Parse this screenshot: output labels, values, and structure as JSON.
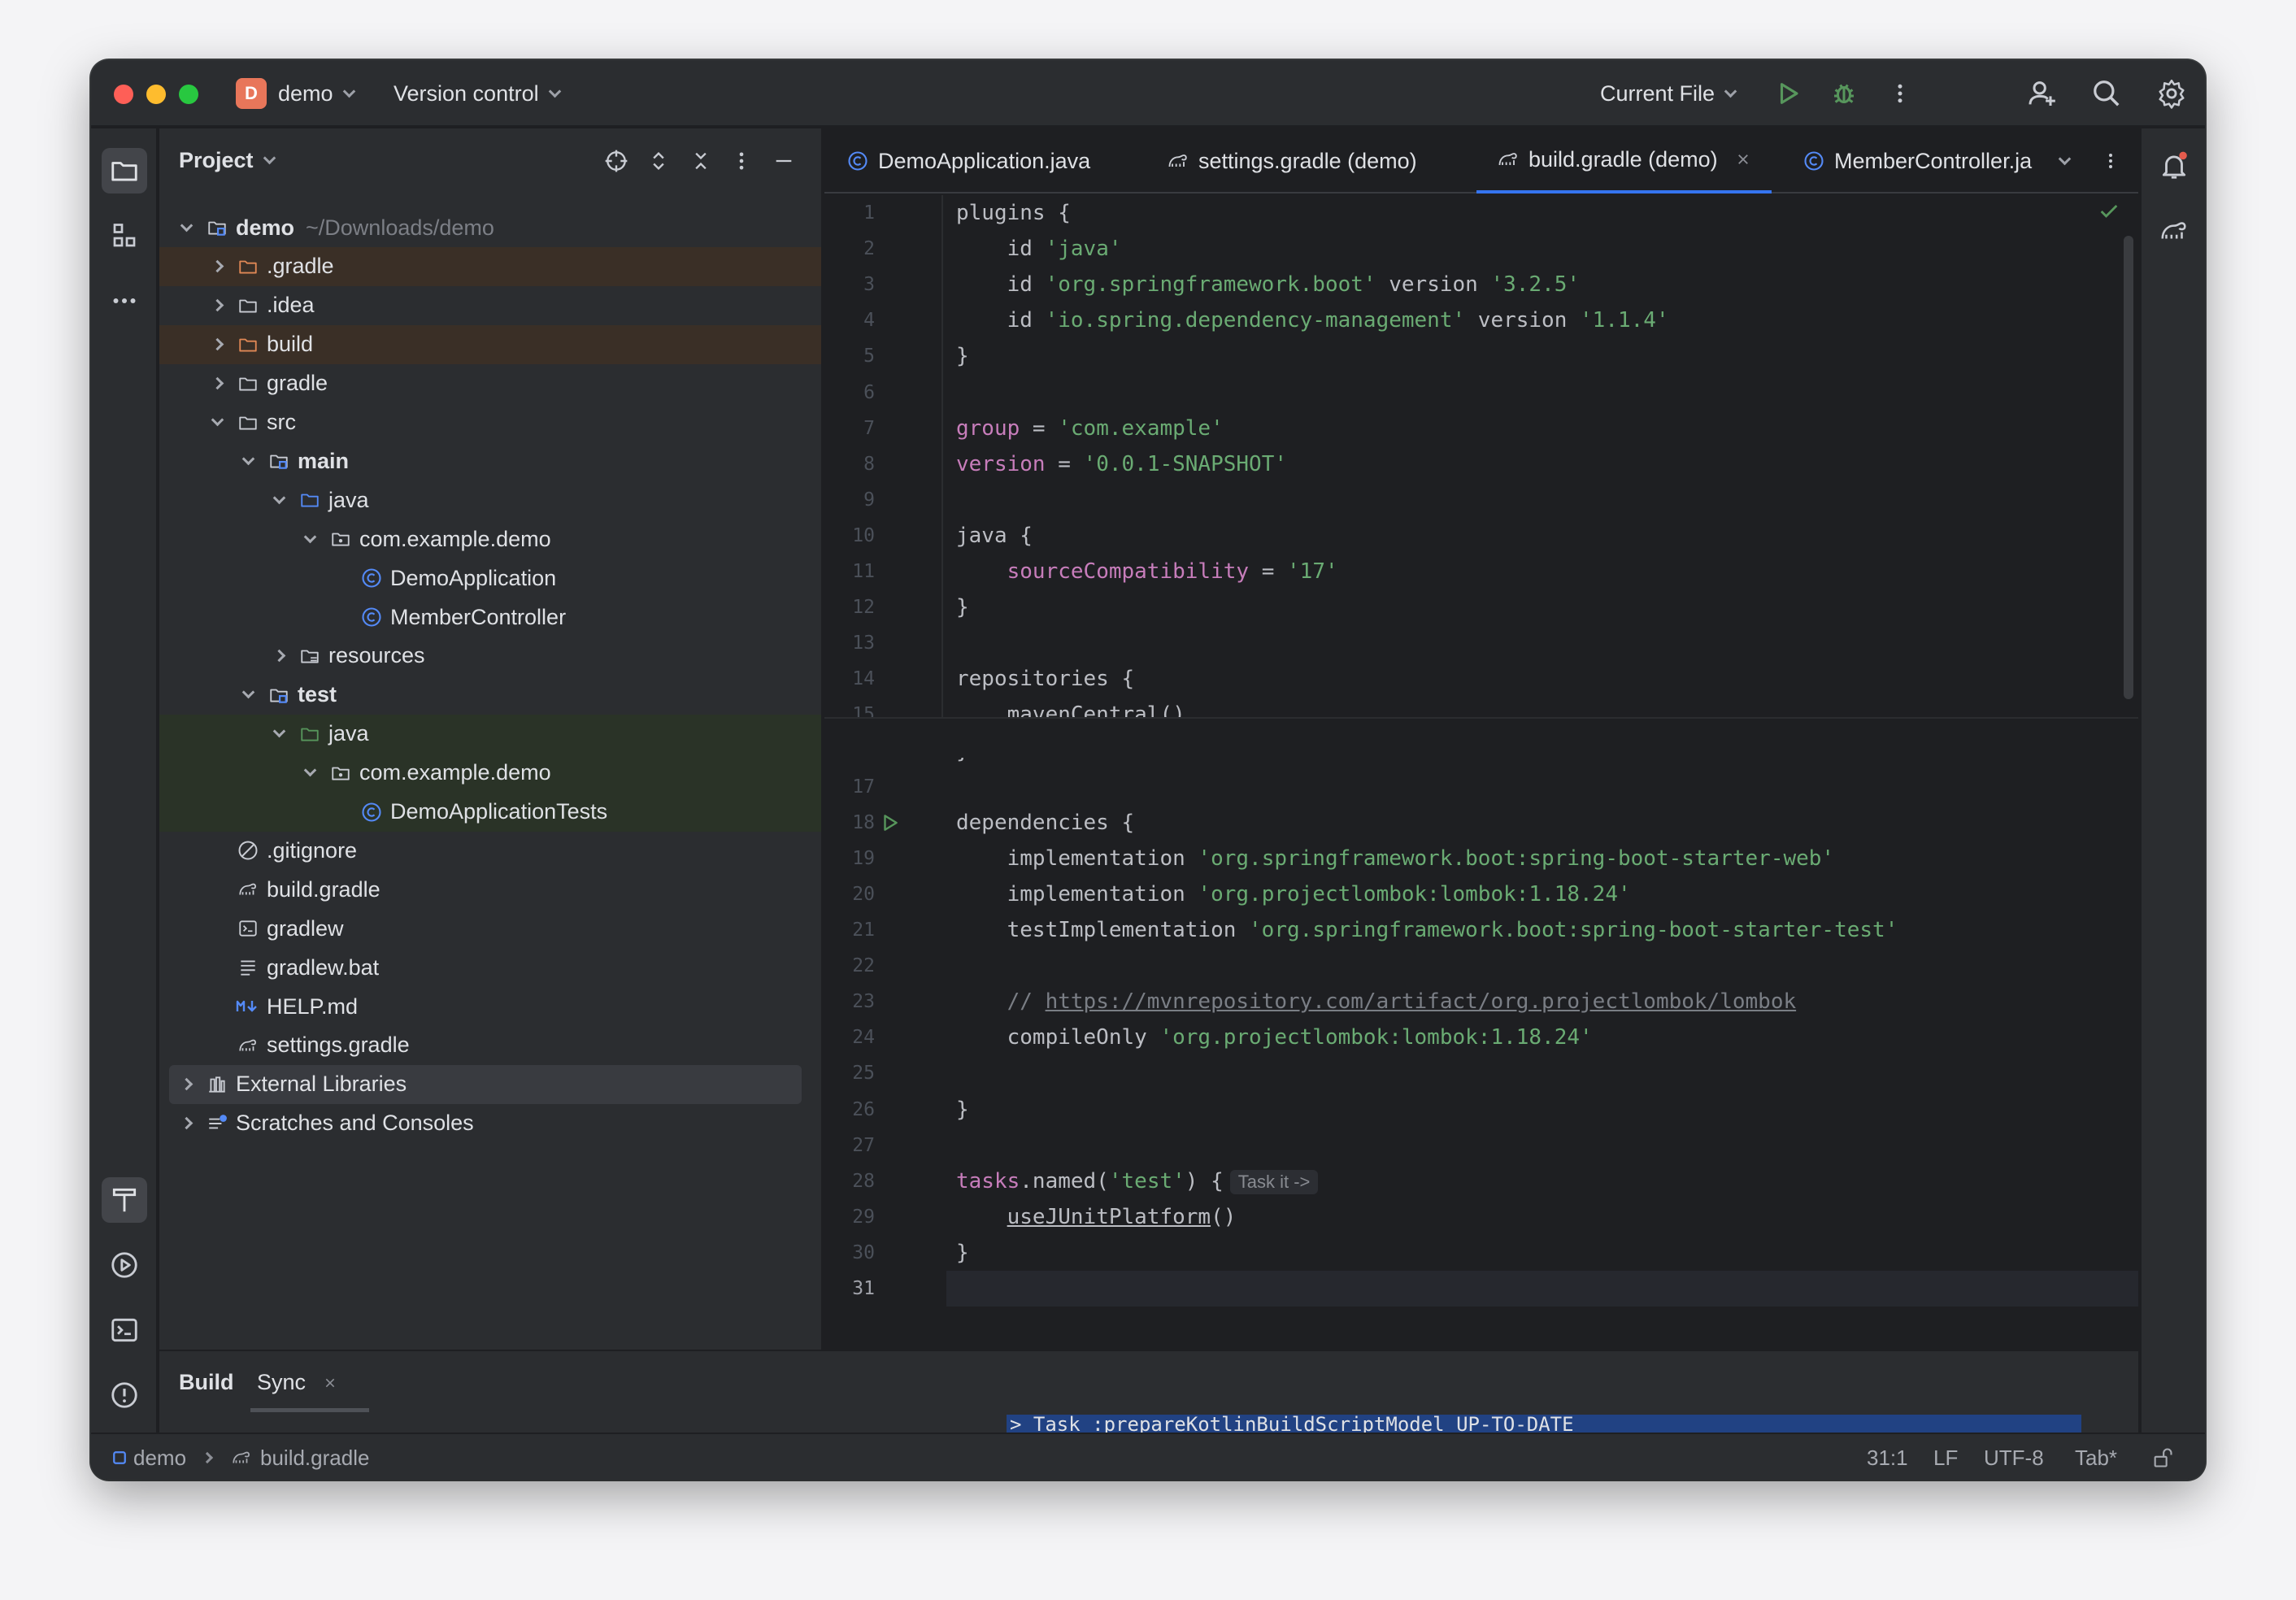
{
  "titlebar": {
    "project_badge": "D",
    "project_name": "demo",
    "vcs_label": "Version control",
    "run_config": "Current File"
  },
  "project_panel": {
    "title": "Project",
    "tree": [
      {
        "label": "demo",
        "hint": "~/Downloads/demo",
        "depth": 0,
        "expanded": true,
        "icon": "module-folder-icon",
        "bold": true
      },
      {
        "label": ".gradle",
        "depth": 1,
        "expanded": false,
        "icon": "excluded-folder-icon",
        "highlight": "excluded"
      },
      {
        "label": ".idea",
        "depth": 1,
        "expanded": false,
        "icon": "folder-icon"
      },
      {
        "label": "build",
        "depth": 1,
        "expanded": false,
        "icon": "excluded-folder-icon",
        "highlight": "excluded"
      },
      {
        "label": "gradle",
        "depth": 1,
        "expanded": false,
        "icon": "folder-icon"
      },
      {
        "label": "src",
        "depth": 1,
        "expanded": true,
        "icon": "folder-icon"
      },
      {
        "label": "main",
        "depth": 2,
        "expanded": true,
        "icon": "module-folder-icon",
        "bold": true
      },
      {
        "label": "java",
        "depth": 3,
        "expanded": true,
        "icon": "source-folder-icon"
      },
      {
        "label": "com.example.demo",
        "depth": 4,
        "expanded": true,
        "icon": "package-icon"
      },
      {
        "label": "DemoApplication",
        "depth": 5,
        "icon": "java-class-icon"
      },
      {
        "label": "MemberController",
        "depth": 5,
        "icon": "java-class-icon"
      },
      {
        "label": "resources",
        "depth": 3,
        "expanded": false,
        "icon": "resources-folder-icon"
      },
      {
        "label": "test",
        "depth": 2,
        "expanded": true,
        "icon": "module-folder-icon",
        "bold": true
      },
      {
        "label": "java",
        "depth": 3,
        "expanded": true,
        "icon": "test-folder-icon",
        "highlight": "test"
      },
      {
        "label": "com.example.demo",
        "depth": 4,
        "expanded": true,
        "icon": "package-icon",
        "highlight": "test"
      },
      {
        "label": "DemoApplicationTests",
        "depth": 5,
        "icon": "java-class-icon",
        "highlight": "test"
      },
      {
        "label": ".gitignore",
        "depth": 1,
        "icon": "gitignore-icon"
      },
      {
        "label": "build.gradle",
        "depth": 1,
        "icon": "gradle-icon"
      },
      {
        "label": "gradlew",
        "depth": 1,
        "icon": "shell-script-icon"
      },
      {
        "label": "gradlew.bat",
        "depth": 1,
        "icon": "text-file-icon"
      },
      {
        "label": "HELP.md",
        "depth": 1,
        "icon": "markdown-icon"
      },
      {
        "label": "settings.gradle",
        "depth": 1,
        "icon": "gradle-icon"
      },
      {
        "label": "External Libraries",
        "depth": 0,
        "expanded": false,
        "icon": "libraries-icon",
        "highlight": "selected"
      },
      {
        "label": "Scratches and Consoles",
        "depth": 0,
        "expanded": false,
        "icon": "scratches-icon"
      }
    ]
  },
  "tabs": [
    {
      "label": "DemoApplication.java",
      "icon": "java-class-icon"
    },
    {
      "label": "settings.gradle (demo)",
      "icon": "gradle-icon"
    },
    {
      "label": "build.gradle (demo)",
      "icon": "gradle-icon",
      "active": true
    },
    {
      "label": "MemberController.ja",
      "icon": "java-class-icon"
    }
  ],
  "editor": {
    "current_line": 31,
    "lines": [
      [
        {
          "t": "plugins {",
          "c": "kw"
        }
      ],
      [
        {
          "t": "    id ",
          "c": "kw"
        },
        {
          "t": "'java'",
          "c": "st"
        }
      ],
      [
        {
          "t": "    id ",
          "c": "kw"
        },
        {
          "t": "'org.springframework.boot'",
          "c": "st"
        },
        {
          "t": " version ",
          "c": "kw"
        },
        {
          "t": "'3.2.5'",
          "c": "st"
        }
      ],
      [
        {
          "t": "    id ",
          "c": "kw"
        },
        {
          "t": "'io.spring.dependency-management'",
          "c": "st"
        },
        {
          "t": " version ",
          "c": "kw"
        },
        {
          "t": "'1.1.4'",
          "c": "st"
        }
      ],
      [
        {
          "t": "}",
          "c": "kw"
        }
      ],
      [],
      [
        {
          "t": "group",
          "c": "pr"
        },
        {
          "t": " = ",
          "c": "kw"
        },
        {
          "t": "'com.example'",
          "c": "st"
        }
      ],
      [
        {
          "t": "version",
          "c": "pr"
        },
        {
          "t": " = ",
          "c": "kw"
        },
        {
          "t": "'0.0.1-SNAPSHOT'",
          "c": "st"
        }
      ],
      [],
      [
        {
          "t": "java {",
          "c": "kw"
        }
      ],
      [
        {
          "t": "    ",
          "c": "kw"
        },
        {
          "t": "sourceCompatibility",
          "c": "pr"
        },
        {
          "t": " = ",
          "c": "kw"
        },
        {
          "t": "'17'",
          "c": "st"
        }
      ],
      [
        {
          "t": "}",
          "c": "kw"
        }
      ],
      [],
      [
        {
          "t": "repositories {",
          "c": "kw"
        }
      ],
      [
        {
          "t": "    mavenCentral()",
          "c": "kw"
        }
      ],
      [
        {
          "t": "}",
          "c": "kw"
        }
      ],
      [],
      [
        {
          "t": "dependencies {",
          "c": "kw"
        }
      ],
      [
        {
          "t": "    implementation ",
          "c": "kw"
        },
        {
          "t": "'org.springframework.boot:spring-boot-starter-web'",
          "c": "st"
        }
      ],
      [
        {
          "t": "    implementation ",
          "c": "kw"
        },
        {
          "t": "'org.projectlombok:lombok:1.18.24'",
          "c": "st"
        }
      ],
      [
        {
          "t": "    testImplementation ",
          "c": "kw"
        },
        {
          "t": "'org.springframework.boot:spring-boot-starter-test'",
          "c": "st"
        }
      ],
      [],
      [
        {
          "t": "    // ",
          "c": "cm"
        },
        {
          "t": "https://mvnrepository.com/artifact/org.projectlombok/lombok",
          "c": "cm ul"
        }
      ],
      [
        {
          "t": "    compileOnly ",
          "c": "kw"
        },
        {
          "t": "'org.projectlombok:lombok:1.18.24'",
          "c": "st"
        }
      ],
      [],
      [
        {
          "t": "}",
          "c": "kw"
        }
      ],
      [],
      [
        {
          "t": "tasks",
          "c": "pr"
        },
        {
          "t": ".named(",
          "c": "kw"
        },
        {
          "t": "'test'",
          "c": "st"
        },
        {
          "t": ") {",
          "c": "kw"
        },
        {
          "t": "Task it ->",
          "c": "hint"
        }
      ],
      [
        {
          "t": "    ",
          "c": "kw"
        },
        {
          "t": "useJUnitPlatform",
          "c": "kw ul"
        },
        {
          "t": "()",
          "c": "kw"
        }
      ],
      [
        {
          "t": "}",
          "c": "kw"
        }
      ],
      []
    ]
  },
  "bottom_panel": {
    "tabs": [
      "Build",
      "Sync"
    ],
    "console_text": "> Task :prepareKotlinBuildScriptModel UP-TO-DATE"
  },
  "statusbar": {
    "breadcrumb_project": "demo",
    "breadcrumb_file": "build.gradle",
    "position": "31:1",
    "line_separator": "LF",
    "encoding": "UTF-8",
    "indent": "Tab*"
  },
  "colors": {
    "accent": "#3574f0",
    "excluded_bg": "#3a2f26",
    "test_bg": "#2a3327",
    "selected_bg": "#393b40"
  }
}
